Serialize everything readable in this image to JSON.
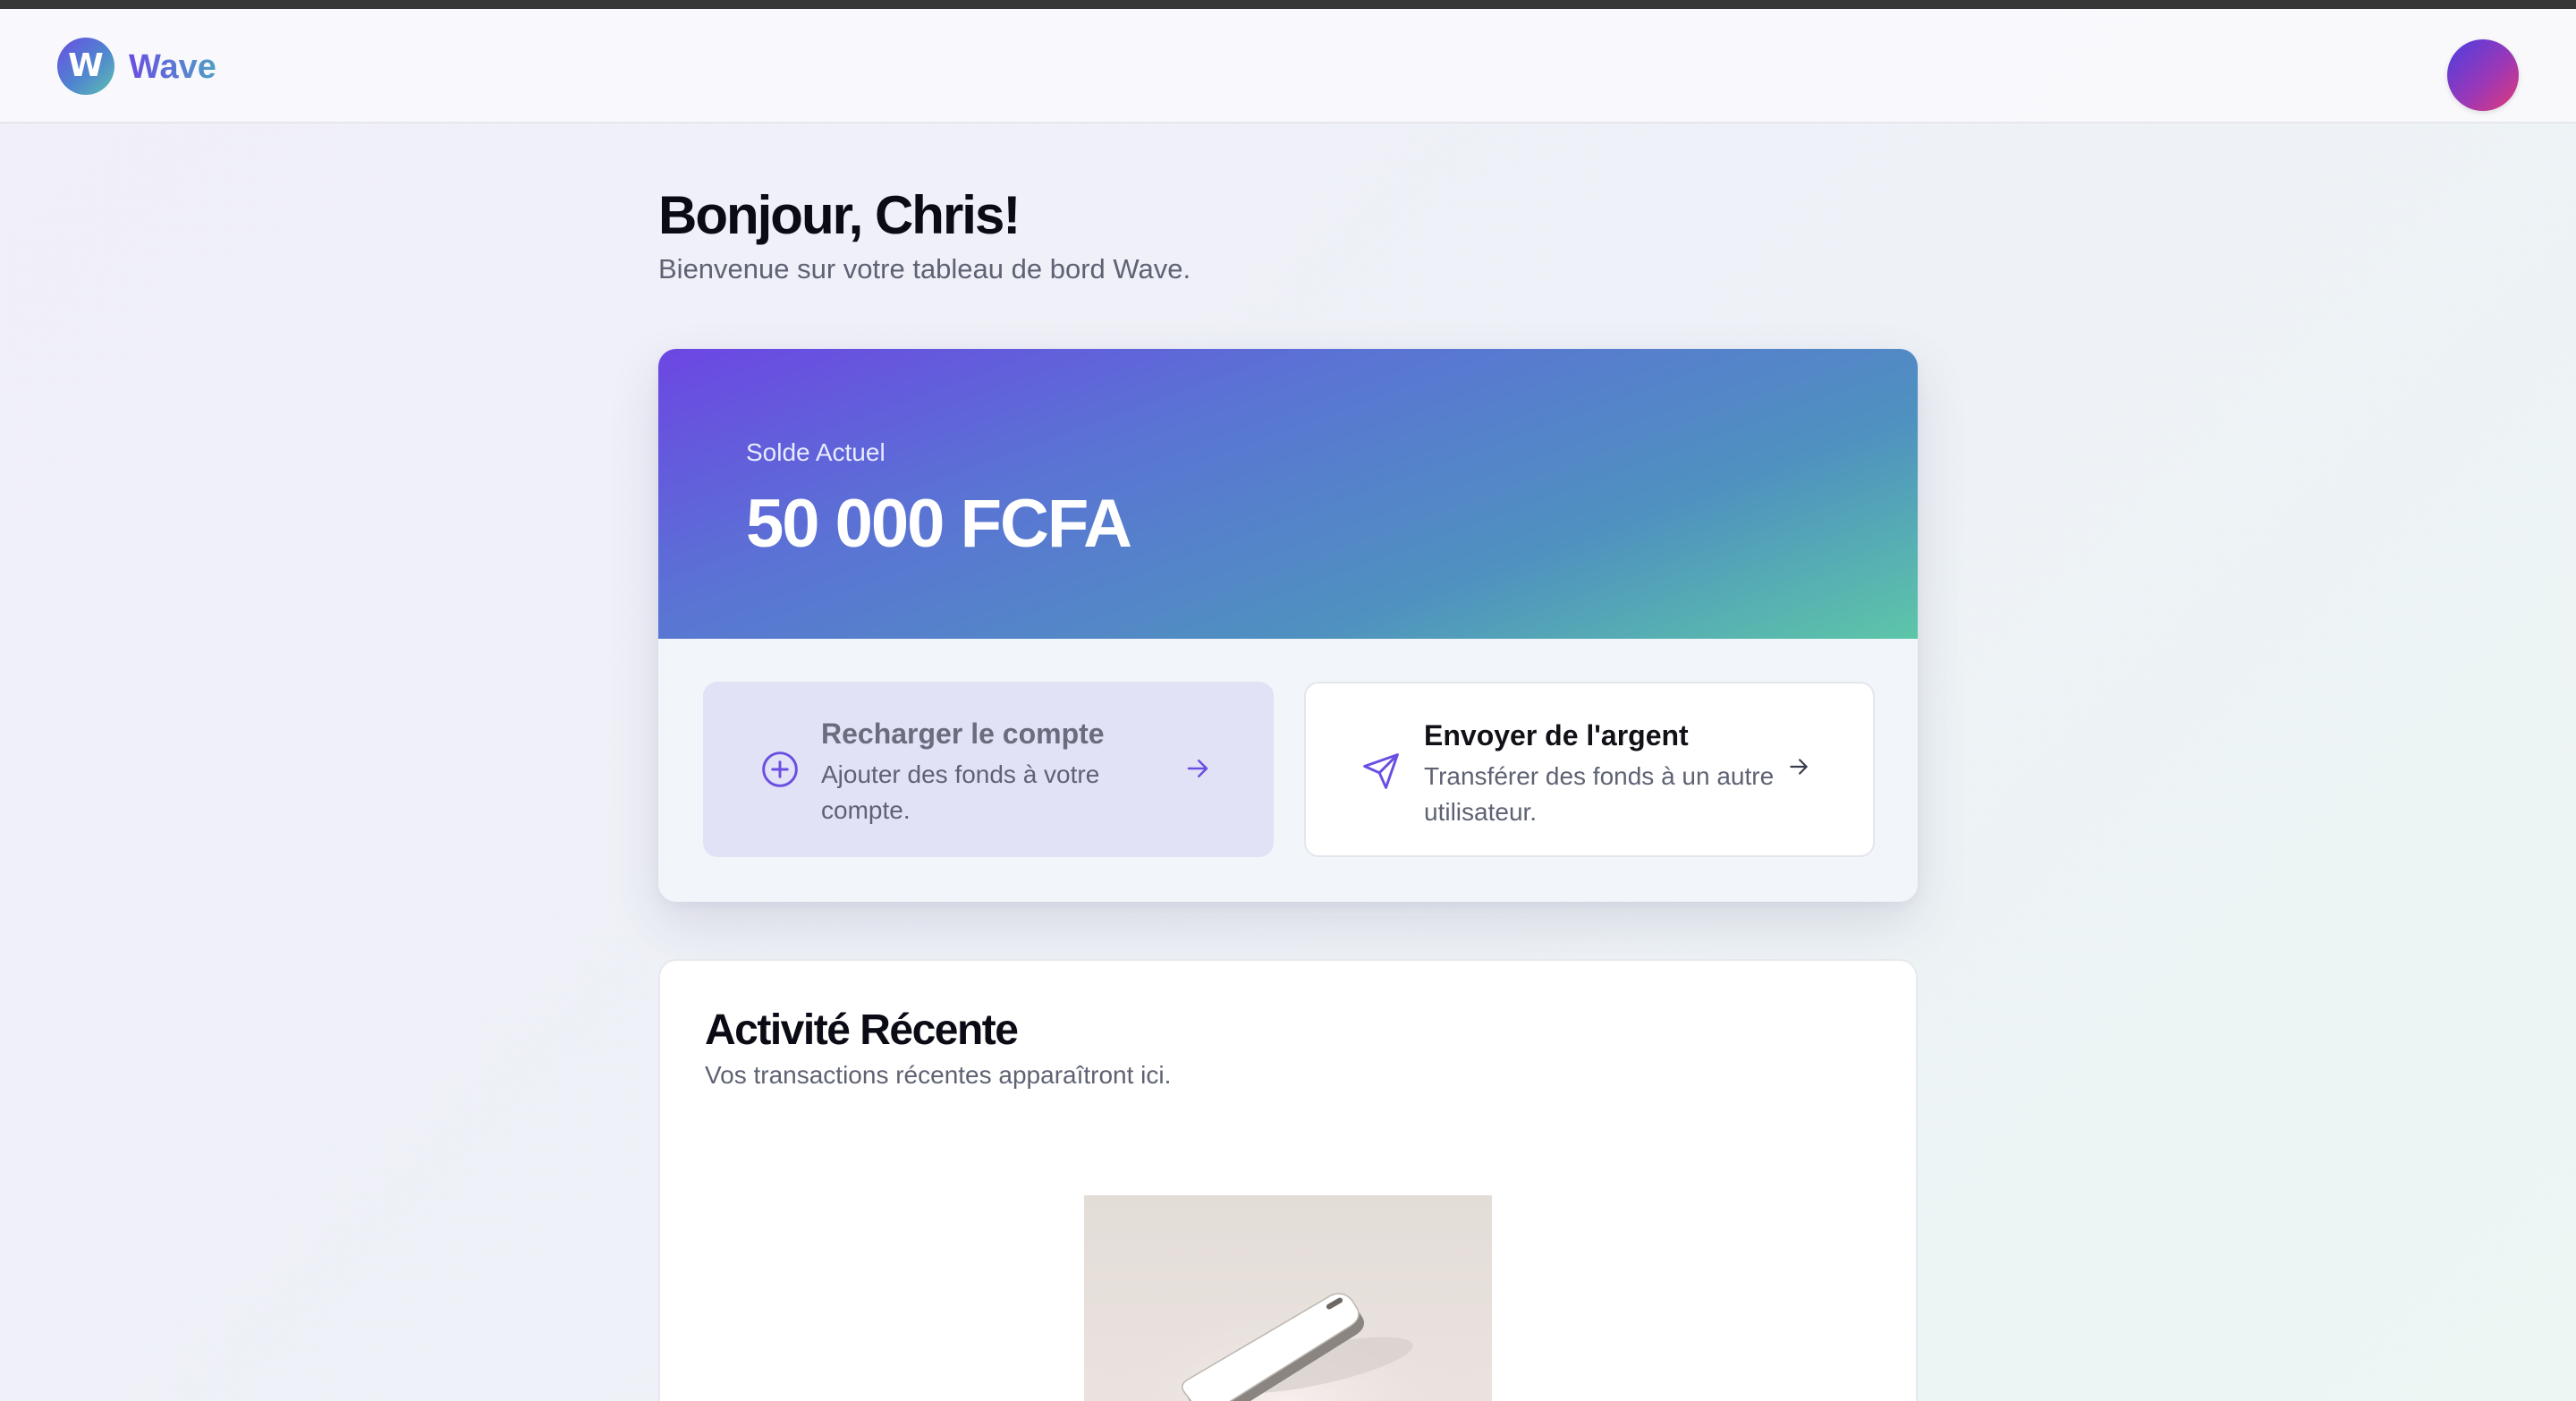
{
  "app": {
    "name": "Wave",
    "logo_letter": "W"
  },
  "greeting": {
    "title": "Bonjour, Chris!",
    "subtitle": "Bienvenue sur votre tableau de bord Wave."
  },
  "balance": {
    "label": "Solde Actuel",
    "value": "50 000 FCFA"
  },
  "actions": [
    {
      "title": "Recharger le compte",
      "description": "Ajouter des fonds à votre compte.",
      "icon": "plus-circle-icon"
    },
    {
      "title": "Envoyer de l'argent",
      "description": "Transférer des fonds à un autre utilisateur.",
      "icon": "send-icon"
    }
  ],
  "activity": {
    "title": "Activité Récente",
    "subtitle": "Vos transactions récentes apparaîtront ici."
  },
  "colors": {
    "accent": "#6a4ee2",
    "accent_teal": "#5ec2ad",
    "action_bg": "#e2e2f6"
  }
}
